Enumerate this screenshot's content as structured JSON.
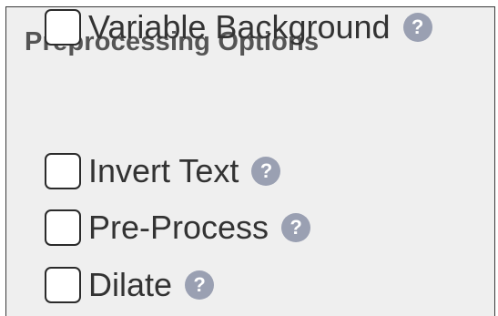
{
  "panel": {
    "title": "Preprocessing Options"
  },
  "options": [
    {
      "label": "Invert Text",
      "checked": false,
      "help_icon": "?"
    },
    {
      "label": "Pre-Process",
      "checked": false,
      "help_icon": "?"
    },
    {
      "label": "Dilate",
      "checked": false,
      "help_icon": "?"
    },
    {
      "label": "Variable Background",
      "checked": false,
      "help_icon": "?"
    }
  ],
  "colors": {
    "panel_background": "#efefef",
    "help_icon_background": "#9aa0b2",
    "title_text": "#555555",
    "label_text": "#333333"
  }
}
